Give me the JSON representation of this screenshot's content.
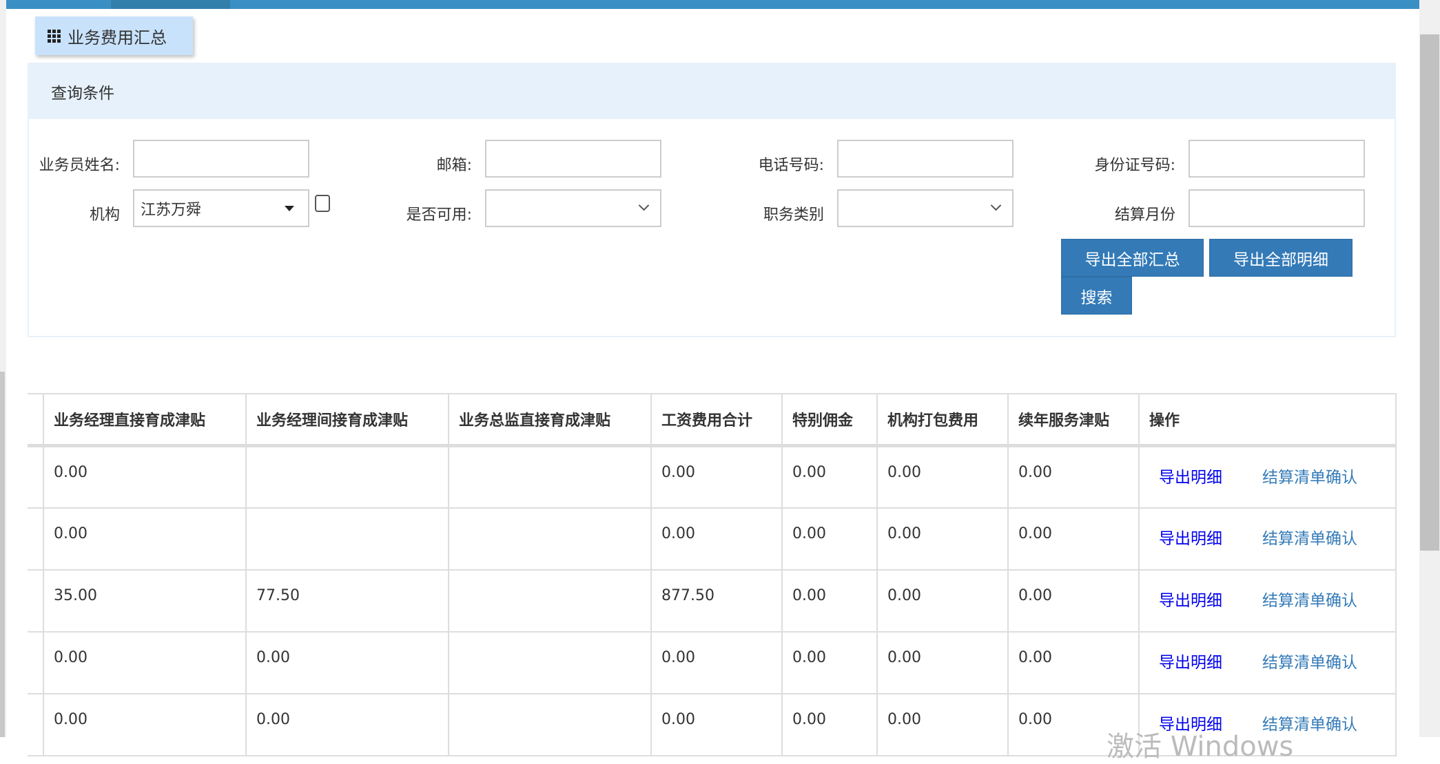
{
  "title": "业务费用汇总",
  "query": {
    "heading": "查询条件",
    "fields": [
      {
        "label": "业务员姓名:",
        "value": ""
      },
      {
        "label": "邮箱:",
        "value": ""
      },
      {
        "label": "电话号码:",
        "value": ""
      },
      {
        "label": "身份证号码:",
        "value": ""
      },
      {
        "label": "机构",
        "value": "江苏万舜"
      },
      {
        "label": "是否可用:",
        "value": ""
      },
      {
        "label": "职务类别",
        "value": ""
      },
      {
        "label": "结算月份",
        "value": ""
      }
    ],
    "buttons": {
      "export_summary": "导出全部汇总",
      "export_detail": "导出全部明细",
      "search": "搜索"
    }
  },
  "table": {
    "headers": [
      "",
      "业务经理直接育成津贴",
      "业务经理间接育成津贴",
      "业务总监直接育成津贴",
      "工资费用合计",
      "特别佣金",
      "机构打包费用",
      "续年服务津贴",
      "操作"
    ],
    "rows": [
      [
        "",
        "0.00",
        "",
        "",
        "0.00",
        "0.00",
        "0.00",
        "0.00"
      ],
      [
        "",
        "0.00",
        "",
        "",
        "0.00",
        "0.00",
        "0.00",
        "0.00"
      ],
      [
        "",
        "35.00",
        "77.50",
        "",
        "877.50",
        "0.00",
        "0.00",
        "0.00"
      ],
      [
        "",
        "0.00",
        "0.00",
        "",
        "0.00",
        "0.00",
        "0.00",
        "0.00"
      ],
      [
        "",
        "0.00",
        "0.00",
        "",
        "0.00",
        "0.00",
        "0.00",
        "0.00"
      ]
    ],
    "actions": {
      "export_detail": "导出明细",
      "confirm": "结算清单确认"
    }
  },
  "watermark": "激活 Windows",
  "colors": {
    "primary": "#337ab7",
    "panel": "#e6f1fb",
    "tab": "#c8e2fb",
    "topbar": "#3a8fc4"
  }
}
